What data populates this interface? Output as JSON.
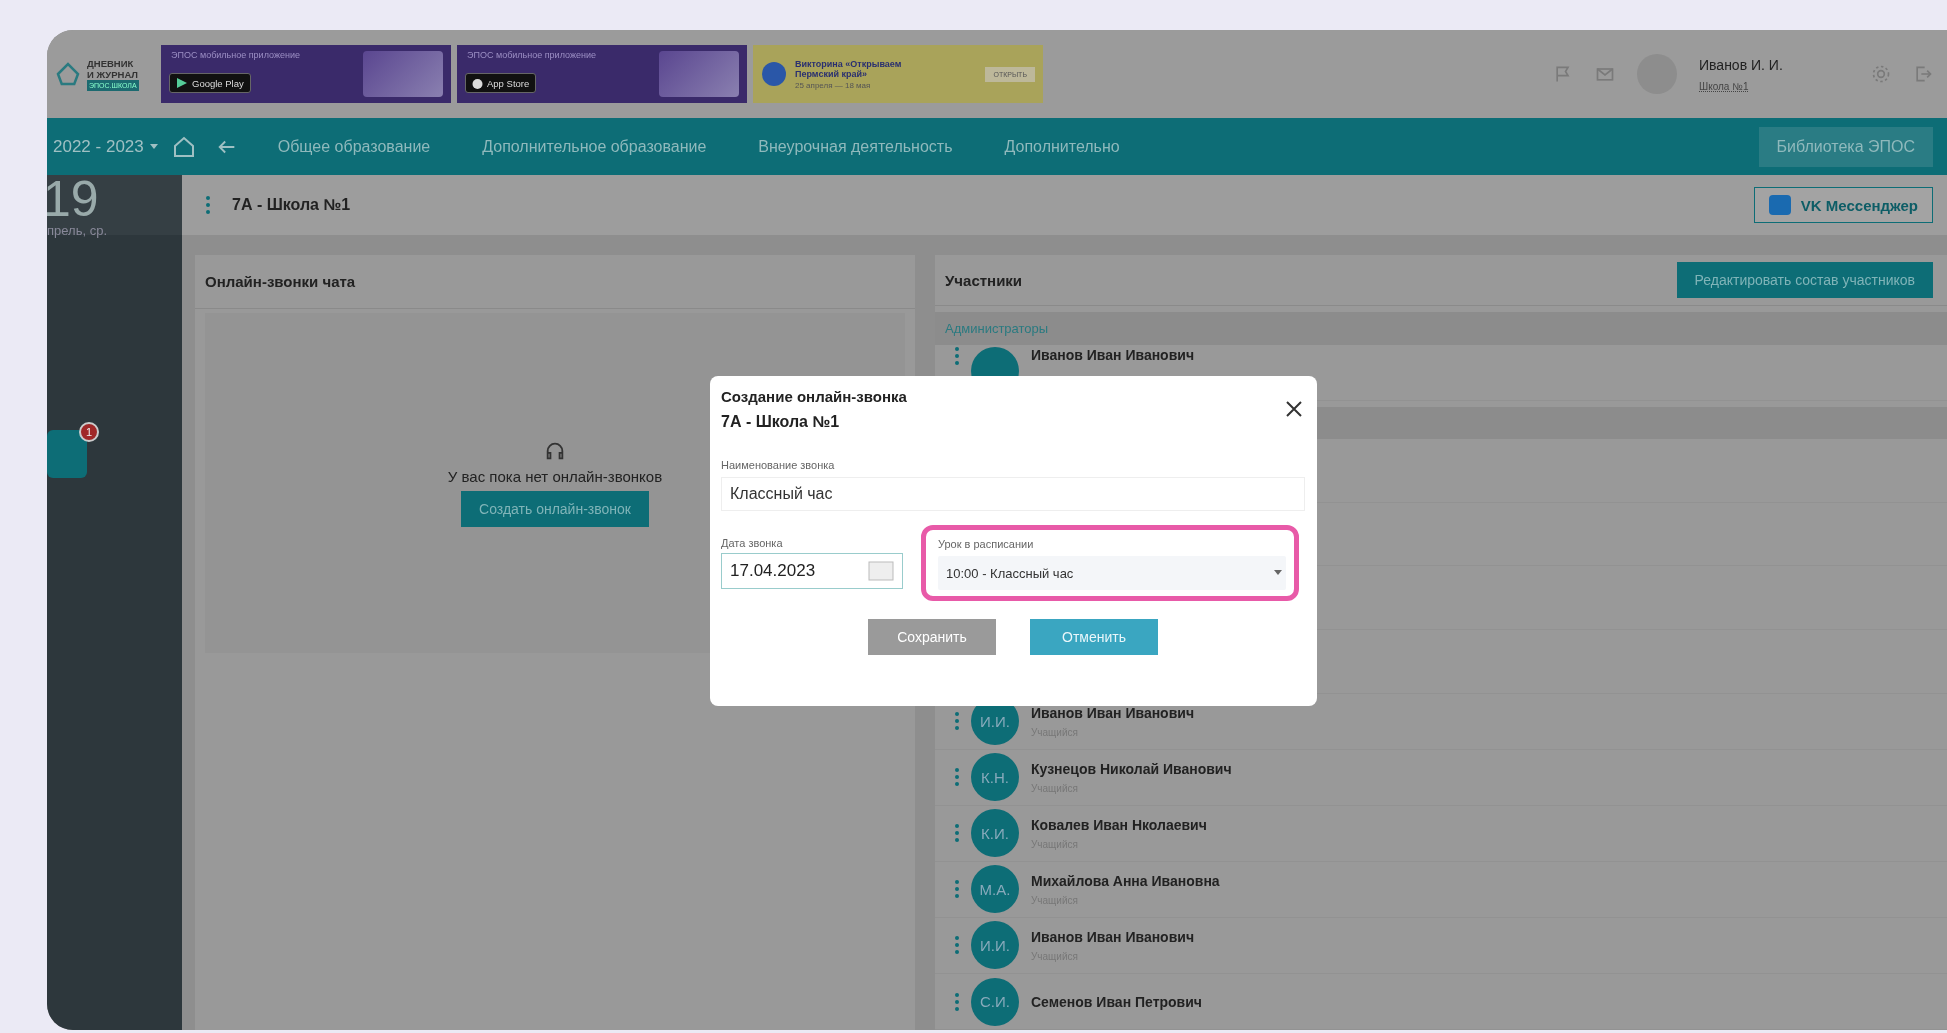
{
  "header": {
    "logo": {
      "line1": "ДНЕВНИК",
      "line2": "И ЖУРНАЛ",
      "line3": "ЭПОС.ШКОЛА"
    },
    "banners": [
      {
        "kind": "googleplay",
        "caption": "ЭПОС мобильное приложение",
        "store": "Google Play"
      },
      {
        "kind": "appstore",
        "caption": "ЭПОС мобильное приложение",
        "store": "App Store"
      },
      {
        "kind": "promo",
        "title": "Викторина «Открываем Пермский край»",
        "dates": "25 апреля — 18 мая",
        "button": "ОТКРЫТЬ"
      }
    ],
    "user": {
      "name": "Иванов И. И.",
      "school": "Школа №1"
    }
  },
  "nav": {
    "year": "2022 - 2023",
    "items": [
      "Общее образование",
      "Дополнительное образование",
      "Внеурочная деятельность",
      "Дополнительно"
    ],
    "library_button": "Библиотека ЭПОС"
  },
  "sidebar": {
    "day": "19",
    "date": "прель, ср.",
    "badge": "1"
  },
  "class_bar": {
    "title": "7А - Школа №1",
    "messenger_button": "VK Мессенджер"
  },
  "calls_panel": {
    "title": "Онлайн-звонки чата",
    "empty_text": "У вас пока нет онлайн-звонков",
    "create_button": "Создать онлайн-звонок"
  },
  "participants": {
    "title": "Участники",
    "edit_button": "Редактировать состав участников",
    "admins": {
      "title": "Администраторы",
      "members": [
        {
          "name": "Иванов Иван Иванович"
        }
      ]
    },
    "students": [
      {
        "initials": "И.И.",
        "name": "Иванов Иван Иванович",
        "role": "Учащийся"
      },
      {
        "initials": "К.Н.",
        "name": "Кузнецов Николай Иванович",
        "role": "Учащийся"
      },
      {
        "initials": "К.И.",
        "name": "Ковалев Иван Нколаевич",
        "role": "Учащийся"
      },
      {
        "initials": "М.А.",
        "name": "Михайлова Анна Ивановна",
        "role": "Учащийся"
      },
      {
        "initials": "И.И.",
        "name": "Иванов Иван Иванович",
        "role": "Учащийся"
      },
      {
        "initials": "С.И.",
        "name": "Семенов Иван Петрович"
      }
    ]
  },
  "modal": {
    "title": "Создание онлайн-звонка",
    "subtitle": "7А - Школа №1",
    "name_field": {
      "label": "Наименование звонка",
      "value": "Классный час"
    },
    "date_field": {
      "label": "Дата звонка",
      "value": "17.04.2023"
    },
    "lesson_field": {
      "label": "Урок в расписании",
      "value": "10:00 - Классный час",
      "highlighted": true
    },
    "buttons": [
      {
        "label": "Сохранить",
        "disabled": true
      },
      {
        "label": "Отменить",
        "disabled": false
      }
    ]
  }
}
